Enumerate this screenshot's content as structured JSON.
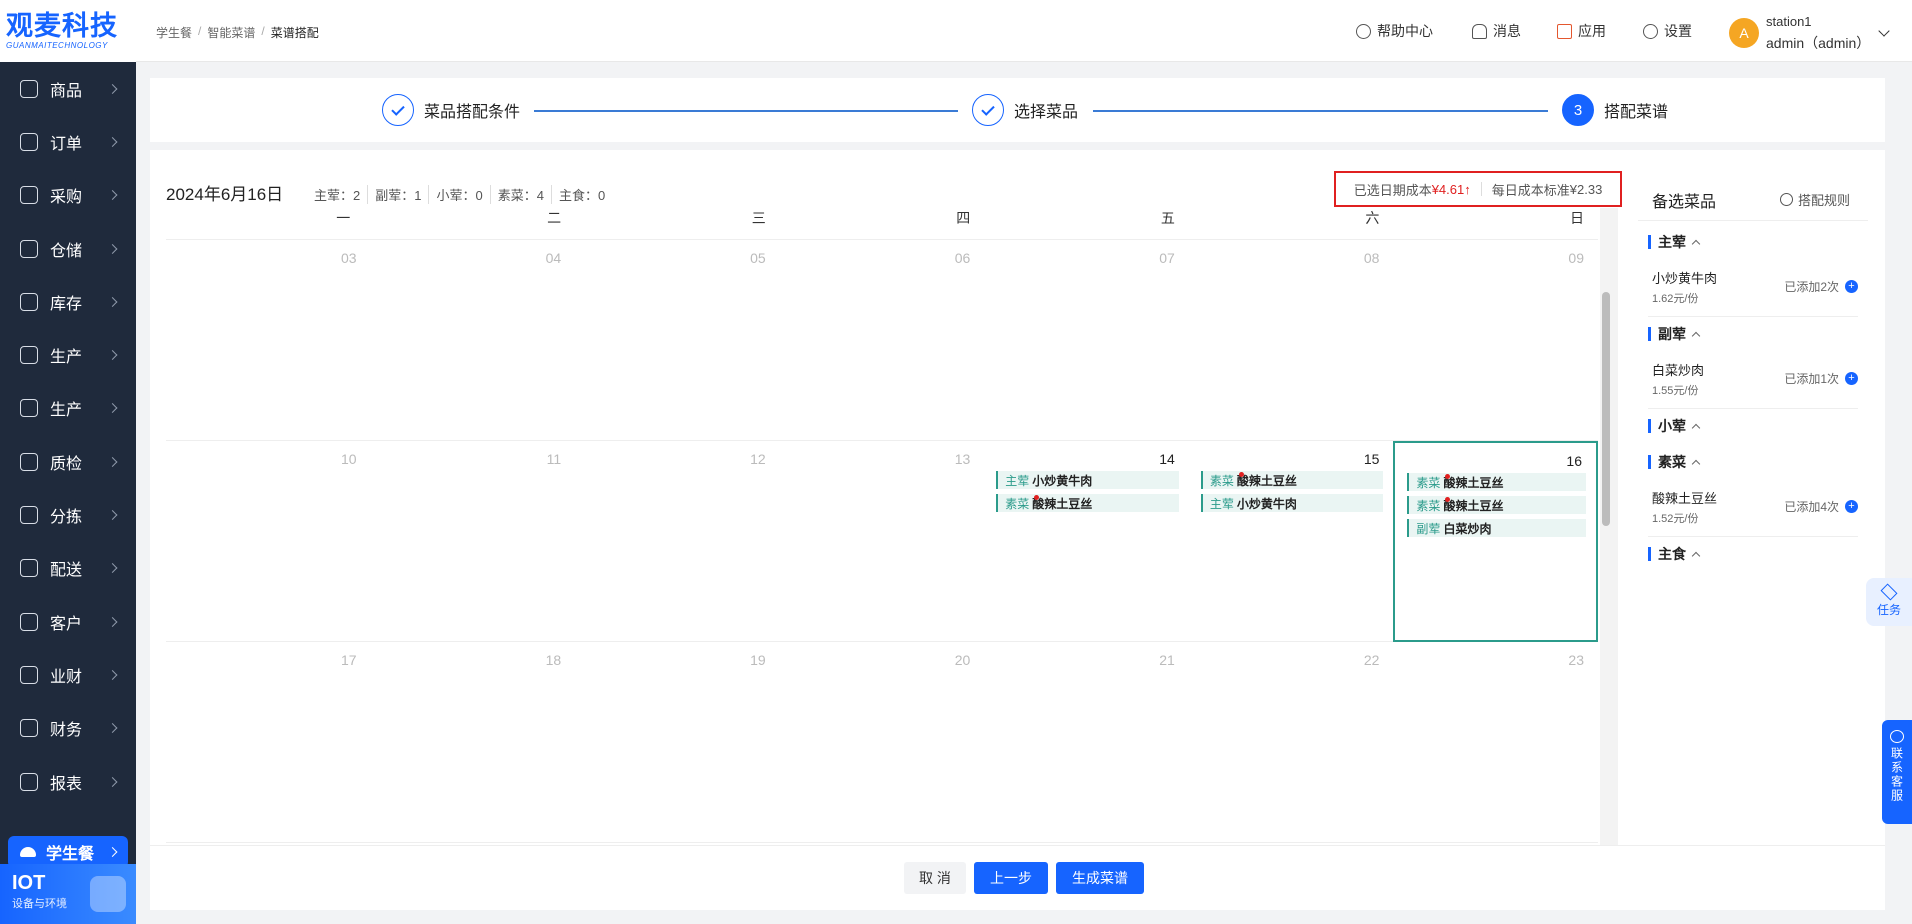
{
  "app": {
    "logo_main": "观麦科技",
    "logo_sub": "GUANMAITECHNOLOGY"
  },
  "sidebar": {
    "items": [
      {
        "label": "商品",
        "icon": "grid-icon"
      },
      {
        "label": "订单",
        "icon": "order-icon"
      },
      {
        "label": "采购",
        "icon": "cart-icon"
      },
      {
        "label": "仓储",
        "icon": "warehouse-icon"
      },
      {
        "label": "库存",
        "icon": "stock-icon"
      },
      {
        "label": "生产",
        "icon": "factory-icon"
      },
      {
        "label": "生产",
        "icon": "chart-icon"
      },
      {
        "label": "质检",
        "icon": "shield-icon"
      },
      {
        "label": "分拣",
        "icon": "sort-icon"
      },
      {
        "label": "配送",
        "icon": "truck-icon"
      },
      {
        "label": "客户",
        "icon": "user-icon"
      },
      {
        "label": "业财",
        "icon": "finance-chart-icon"
      },
      {
        "label": "财务",
        "icon": "money-icon"
      },
      {
        "label": "报表",
        "icon": "pie-icon"
      }
    ],
    "active": {
      "label": "学生餐",
      "icon": "cloud-icon"
    },
    "iot": {
      "title": "IOT",
      "subtitle": "设备与环境"
    }
  },
  "header": {
    "breadcrumb": [
      "学生餐",
      "智能菜谱",
      "菜谱搭配"
    ],
    "help": "帮助中心",
    "messages": "消息",
    "apps": "应用",
    "settings": "设置",
    "avatar_letter": "A",
    "station": "station1",
    "user": "admin（admin）"
  },
  "steps": [
    {
      "label": "菜品搭配条件",
      "state": "done"
    },
    {
      "label": "选择菜品",
      "state": "done"
    },
    {
      "label": "搭配菜谱",
      "state": "active",
      "number": "3"
    }
  ],
  "calendar": {
    "date_title": "2024年6月16日",
    "counts": [
      "主荤：2",
      "副荤：1",
      "小荤：0",
      "素菜：4",
      "主食：0"
    ],
    "cost_selected_label": "已选日期成本",
    "cost_selected_value": "¥4.61",
    "cost_daily_label": "每日成本标准",
    "cost_daily_value": "¥2.33",
    "weekdays": [
      "一",
      "二",
      "三",
      "四",
      "五",
      "六",
      "日"
    ],
    "weeks": [
      [
        {
          "day": "03"
        },
        {
          "day": "04"
        },
        {
          "day": "05"
        },
        {
          "day": "06"
        },
        {
          "day": "07"
        },
        {
          "day": "08"
        },
        {
          "day": "09"
        }
      ],
      [
        {
          "day": "10"
        },
        {
          "day": "11"
        },
        {
          "day": "12"
        },
        {
          "day": "13"
        },
        {
          "day": "14",
          "current": true,
          "dishes": [
            {
              "cat": "主荤",
              "name": "小炒黄牛肉",
              "dot": false
            },
            {
              "cat": "素菜",
              "name": "酸辣土豆丝",
              "dot": true
            }
          ]
        },
        {
          "day": "15",
          "current": true,
          "dishes": [
            {
              "cat": "素菜",
              "name": "酸辣土豆丝",
              "dot": true
            },
            {
              "cat": "主荤",
              "name": "小炒黄牛肉",
              "dot": false
            }
          ]
        },
        {
          "day": "16",
          "current": true,
          "selected": true,
          "dishes": [
            {
              "cat": "素菜",
              "name": "酸辣土豆丝",
              "dot": true
            },
            {
              "cat": "素菜",
              "name": "酸辣土豆丝",
              "dot": true
            },
            {
              "cat": "副荤",
              "name": "白菜炒肉",
              "dot": false
            }
          ]
        }
      ],
      [
        {
          "day": "17"
        },
        {
          "day": "18"
        },
        {
          "day": "19"
        },
        {
          "day": "20"
        },
        {
          "day": "21"
        },
        {
          "day": "22"
        },
        {
          "day": "23"
        }
      ]
    ]
  },
  "side_panel": {
    "title": "备选菜品",
    "rules": "搭配规则",
    "groups": [
      {
        "name": "主荤",
        "items": [
          {
            "name": "小炒黄牛肉",
            "price": "1.62元/份",
            "added": "已添加2次"
          }
        ]
      },
      {
        "name": "副荤",
        "items": [
          {
            "name": "白菜炒肉",
            "price": "1.55元/份",
            "added": "已添加1次"
          }
        ]
      },
      {
        "name": "小荤",
        "items": []
      },
      {
        "name": "素菜",
        "items": [
          {
            "name": "酸辣土豆丝",
            "price": "1.52元/份",
            "added": "已添加4次"
          }
        ]
      },
      {
        "name": "主食",
        "items": []
      }
    ]
  },
  "footer": {
    "cancel": "取 消",
    "prev": "上一步",
    "generate": "生成菜谱"
  },
  "floats": {
    "task": "任务",
    "service": "联系客服"
  },
  "colors": {
    "primary": "#1664ff",
    "sidebar_bg": "#1f2a3c",
    "accent_teal": "#2b9b8b",
    "alert_red": "#e02020"
  }
}
